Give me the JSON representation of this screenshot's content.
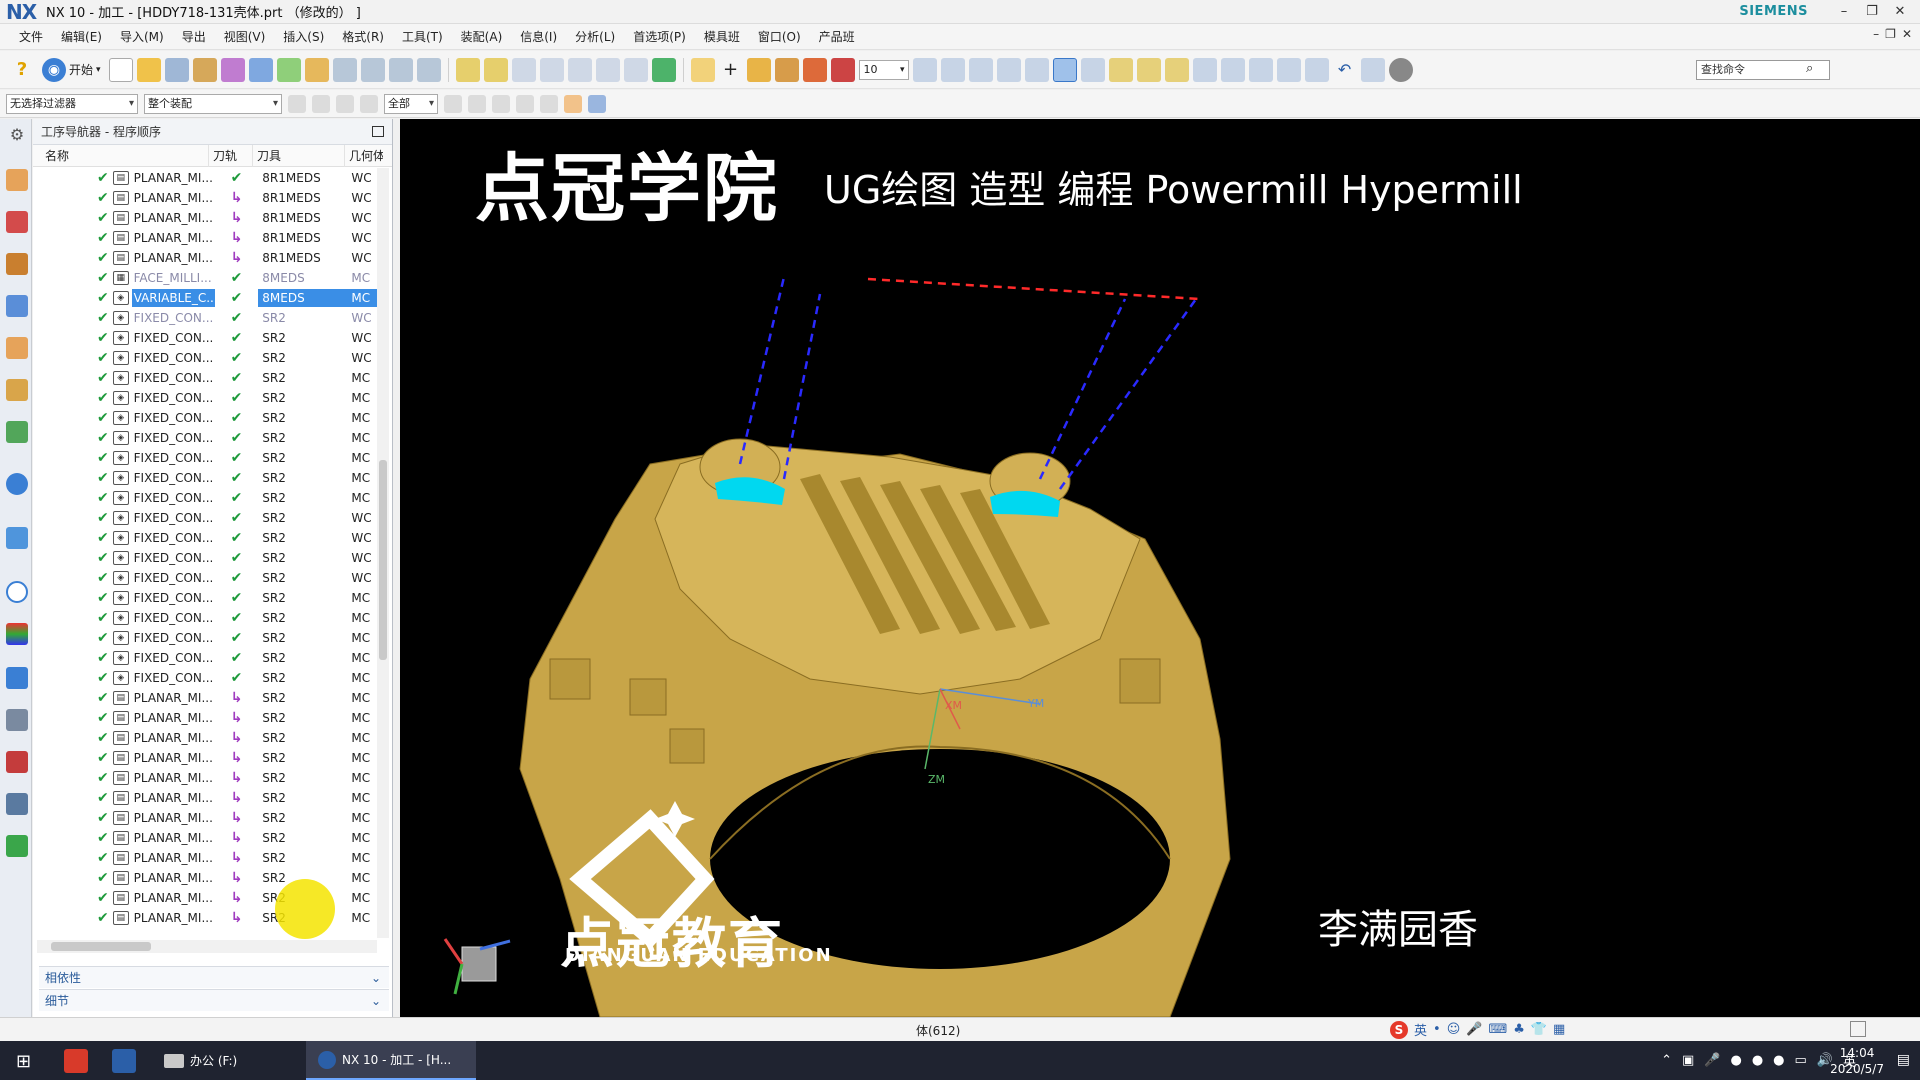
{
  "app": {
    "logo": "NX",
    "window_title": "NX 10 - 加工 - [HDDY718-131壳体.prt （修改的） ]",
    "vendor": "SIEMENS",
    "win_controls": [
      "–",
      "❐",
      "✕"
    ],
    "doc_controls": [
      "–",
      "❐",
      "✕"
    ]
  },
  "menu": {
    "items": [
      "文件",
      "编辑(E)",
      "导入(M)",
      "导出",
      "视图(V)",
      "插入(S)",
      "格式(R)",
      "工具(T)",
      "装配(A)",
      "信息(I)",
      "分析(L)",
      "首选项(P)",
      "模具班",
      "窗口(O)",
      "产品班"
    ]
  },
  "toolbar": {
    "start_label": "开始",
    "zoom_value": "10",
    "search_placeholder": "查找命令"
  },
  "filters": {
    "selection_filter": "无选择过滤器",
    "assembly_scope": "整个装配",
    "type_filter": "全部"
  },
  "navigator": {
    "title": "工序导航器 - 程序顺序",
    "columns": [
      "名称",
      "刀轨",
      "刀具",
      "几何体"
    ],
    "rows": [
      {
        "name": "PLANAR_MI...",
        "path": "ok",
        "tool": "8R1MEDS",
        "geo": "WC"
      },
      {
        "name": "PLANAR_MI...",
        "path": "regen",
        "tool": "8R1MEDS",
        "geo": "WC"
      },
      {
        "name": "PLANAR_MI...",
        "path": "regen",
        "tool": "8R1MEDS",
        "geo": "WC"
      },
      {
        "name": "PLANAR_MI...",
        "path": "regen",
        "tool": "8R1MEDS",
        "geo": "WC"
      },
      {
        "name": "PLANAR_MI...",
        "path": "regen",
        "tool": "8R1MEDS",
        "geo": "WC"
      },
      {
        "name": "FACE_MILLI...",
        "path": "ok",
        "tool": "8MEDS",
        "geo": "MC",
        "grey": true
      },
      {
        "name": "VARIABLE_C...",
        "path": "ok",
        "tool": "8MEDS",
        "geo": "MC",
        "selected": true
      },
      {
        "name": "FIXED_CON...",
        "path": "ok",
        "tool": "SR2",
        "geo": "WC",
        "grey": true
      },
      {
        "name": "FIXED_CON...",
        "path": "ok",
        "tool": "SR2",
        "geo": "WC"
      },
      {
        "name": "FIXED_CON...",
        "path": "ok",
        "tool": "SR2",
        "geo": "WC"
      },
      {
        "name": "FIXED_CON...",
        "path": "ok",
        "tool": "SR2",
        "geo": "MC"
      },
      {
        "name": "FIXED_CON...",
        "path": "ok",
        "tool": "SR2",
        "geo": "MC"
      },
      {
        "name": "FIXED_CON...",
        "path": "ok",
        "tool": "SR2",
        "geo": "MC"
      },
      {
        "name": "FIXED_CON...",
        "path": "ok",
        "tool": "SR2",
        "geo": "MC"
      },
      {
        "name": "FIXED_CON...",
        "path": "ok",
        "tool": "SR2",
        "geo": "MC"
      },
      {
        "name": "FIXED_CON...",
        "path": "ok",
        "tool": "SR2",
        "geo": "MC"
      },
      {
        "name": "FIXED_CON...",
        "path": "ok",
        "tool": "SR2",
        "geo": "MC"
      },
      {
        "name": "FIXED_CON...",
        "path": "ok",
        "tool": "SR2",
        "geo": "WC"
      },
      {
        "name": "FIXED_CON...",
        "path": "ok",
        "tool": "SR2",
        "geo": "WC"
      },
      {
        "name": "FIXED_CON...",
        "path": "ok",
        "tool": "SR2",
        "geo": "WC"
      },
      {
        "name": "FIXED_CON...",
        "path": "ok",
        "tool": "SR2",
        "geo": "WC"
      },
      {
        "name": "FIXED_CON...",
        "path": "ok",
        "tool": "SR2",
        "geo": "MC"
      },
      {
        "name": "FIXED_CON...",
        "path": "ok",
        "tool": "SR2",
        "geo": "MC"
      },
      {
        "name": "FIXED_CON...",
        "path": "ok",
        "tool": "SR2",
        "geo": "MC"
      },
      {
        "name": "FIXED_CON...",
        "path": "ok",
        "tool": "SR2",
        "geo": "MC"
      },
      {
        "name": "FIXED_CON...",
        "path": "ok",
        "tool": "SR2",
        "geo": "MC"
      },
      {
        "name": "PLANAR_MI...",
        "path": "regen",
        "tool": "SR2",
        "geo": "MC"
      },
      {
        "name": "PLANAR_MI...",
        "path": "regen",
        "tool": "SR2",
        "geo": "MC"
      },
      {
        "name": "PLANAR_MI...",
        "path": "regen",
        "tool": "SR2",
        "geo": "MC"
      },
      {
        "name": "PLANAR_MI...",
        "path": "regen",
        "tool": "SR2",
        "geo": "MC"
      },
      {
        "name": "PLANAR_MI...",
        "path": "regen",
        "tool": "SR2",
        "geo": "MC"
      },
      {
        "name": "PLANAR_MI...",
        "path": "regen",
        "tool": "SR2",
        "geo": "MC"
      },
      {
        "name": "PLANAR_MI...",
        "path": "regen",
        "tool": "SR2",
        "geo": "MC"
      },
      {
        "name": "PLANAR_MI...",
        "path": "regen",
        "tool": "SR2",
        "geo": "MC"
      },
      {
        "name": "PLANAR_MI...",
        "path": "regen",
        "tool": "SR2",
        "geo": "MC"
      },
      {
        "name": "PLANAR_MI...",
        "path": "regen",
        "tool": "SR2",
        "geo": "MC"
      },
      {
        "name": "PLANAR_MI...",
        "path": "regen",
        "tool": "SR2",
        "geo": "MC"
      },
      {
        "name": "PLANAR_MI...",
        "path": "regen",
        "tool": "SR2",
        "geo": "MC"
      }
    ],
    "dependencies_label": "相依性",
    "details_label": "细节"
  },
  "viewport": {
    "brand_title": "点冠学院",
    "brand_subtitle": "UG绘图 造型 编程 Powermill Hypermill",
    "edu_cn": "点冠教育",
    "edu_en": "DIANGUAN EDUCATION",
    "watermark": "李满园香",
    "axis_labels": {
      "xm": "XM",
      "ym": "YM",
      "zm": "ZM"
    },
    "part_color": "#c8a548",
    "highlight_color": "#00d8f0"
  },
  "status": {
    "text": "体(612)",
    "ime": [
      "S",
      "英",
      "•",
      "☺",
      "🎤",
      "⌨",
      "♣",
      "👕",
      "▦"
    ]
  },
  "taskbar": {
    "office_label": "办公 (F:)",
    "nx_label": "NX 10 - 加工 - [H...",
    "ime_lang": "英",
    "time": "14:04",
    "date": "2020/5/7"
  }
}
